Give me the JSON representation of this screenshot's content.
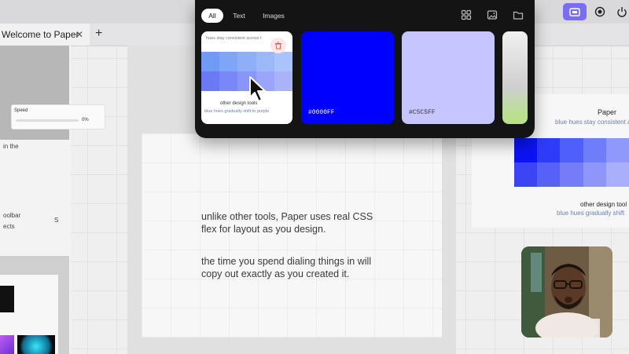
{
  "tabs": [
    {
      "label": "Welcome to Paper",
      "close": "✕"
    }
  ],
  "tab_add": "+",
  "left_panel": {
    "speed_label": "Speed",
    "speed_value": "0%",
    "fragment_1": "in the",
    "fragment_2": "oolbar",
    "fragment_3": "ects",
    "fragment_4": "S"
  },
  "popup": {
    "filters": [
      "All",
      "Text",
      "Images"
    ],
    "active_filter": "All",
    "icons": [
      "grid-icon",
      "image-icon",
      "folder-icon"
    ],
    "items": [
      {
        "kind": "frame",
        "subtitle": "hues stay consistent across t",
        "caption": "other design tools",
        "caption2": "blue hues gradually shift to purple"
      },
      {
        "kind": "color",
        "hex": "#0000FF",
        "color": "#0000ff"
      },
      {
        "kind": "color",
        "hex": "#C5C5FF",
        "color": "#c5c5ff"
      },
      {
        "kind": "image"
      }
    ]
  },
  "canvas": {
    "paragraph_1": [
      "unlike other tools, Paper uses real CSS",
      "flex for layout as you design."
    ],
    "paragraph_2": [
      "the time you spend dialing things in will",
      "copy out exactly as you created it."
    ]
  },
  "right_card": {
    "title": "Paper",
    "subtitle": "blue hues stay consistent ac",
    "title2": "other design tool",
    "subtitle2": "blue hues gradually shift"
  },
  "colors": {
    "accent": "#7a6cf5",
    "blue": "#0000ff",
    "lavender": "#c5c5ff"
  }
}
